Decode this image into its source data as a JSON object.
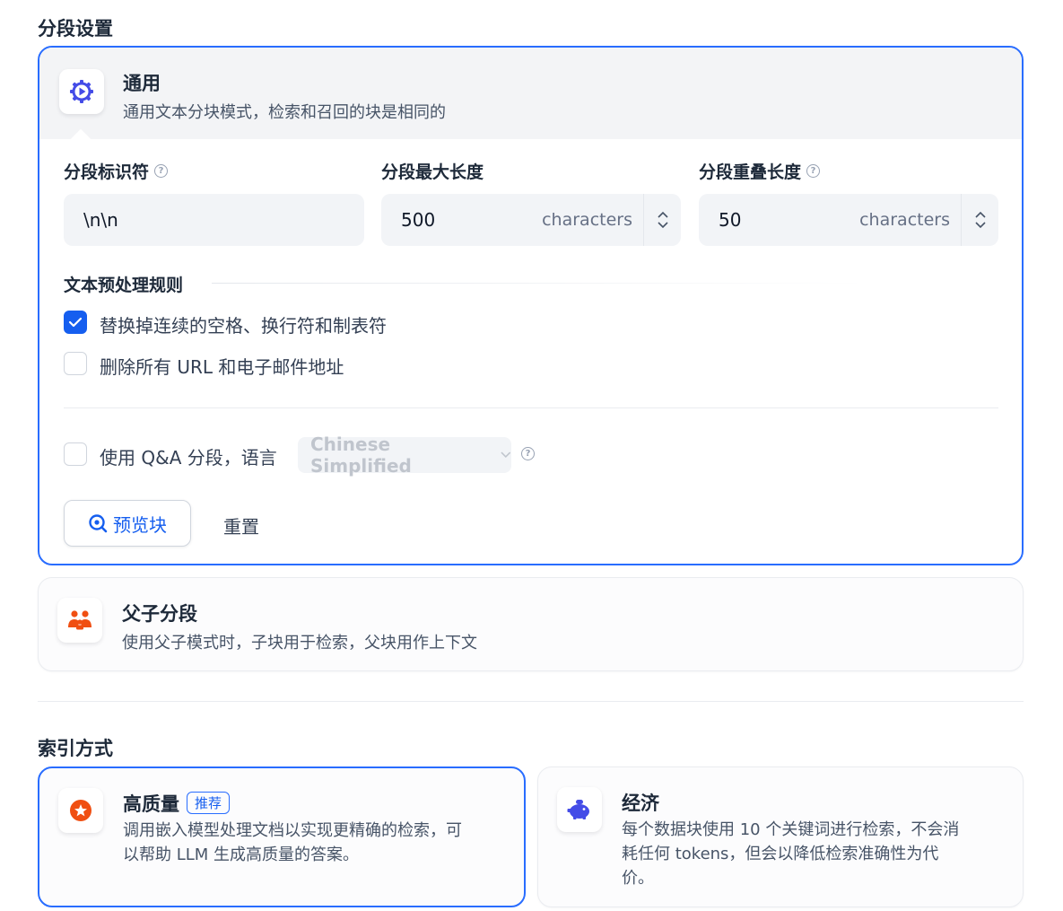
{
  "segment_settings": {
    "title": "分段设置"
  },
  "general": {
    "title": "通用",
    "description": "通用文本分块模式，检索和召回的块是相同的",
    "separator": {
      "label": "分段标识符",
      "value": "\\n\\n"
    },
    "max_length": {
      "label": "分段最大长度",
      "value": "500",
      "unit": "characters"
    },
    "overlap": {
      "label": "分段重叠长度",
      "value": "50",
      "unit": "characters"
    },
    "preprocess": {
      "title": "文本预处理规则",
      "rules": [
        {
          "label": "替换掉连续的空格、换行符和制表符",
          "checked": true
        },
        {
          "label": "删除所有 URL 和电子邮件地址",
          "checked": false
        }
      ]
    },
    "qa": {
      "label": "使用 Q&A 分段，语言",
      "checked": false,
      "language": "Chinese Simplified"
    },
    "preview_button": "预览块",
    "reset_button": "重置"
  },
  "parent_child": {
    "title": "父子分段",
    "description": "使用父子模式时，子块用于检索，父块用作上下文"
  },
  "index_method": {
    "title": "索引方式",
    "high_quality": {
      "title": "高质量",
      "badge": "推荐",
      "description_line1": "调用嵌入模型处理文档以实现更精确的检索，可",
      "description_line2": "以帮助 LLM 生成高质量的答案。"
    },
    "economy": {
      "title": "经济",
      "description_line1": "每个数据块使用 10 个关键词进行检索，不会消",
      "description_line2": "耗任何 tokens，但会以降低检索准确性为代",
      "description_line3": "价。"
    }
  },
  "colors": {
    "accent": "#296dff",
    "primary": "#155eef",
    "orange": "#f04f12",
    "indigo": "#444ce7"
  }
}
